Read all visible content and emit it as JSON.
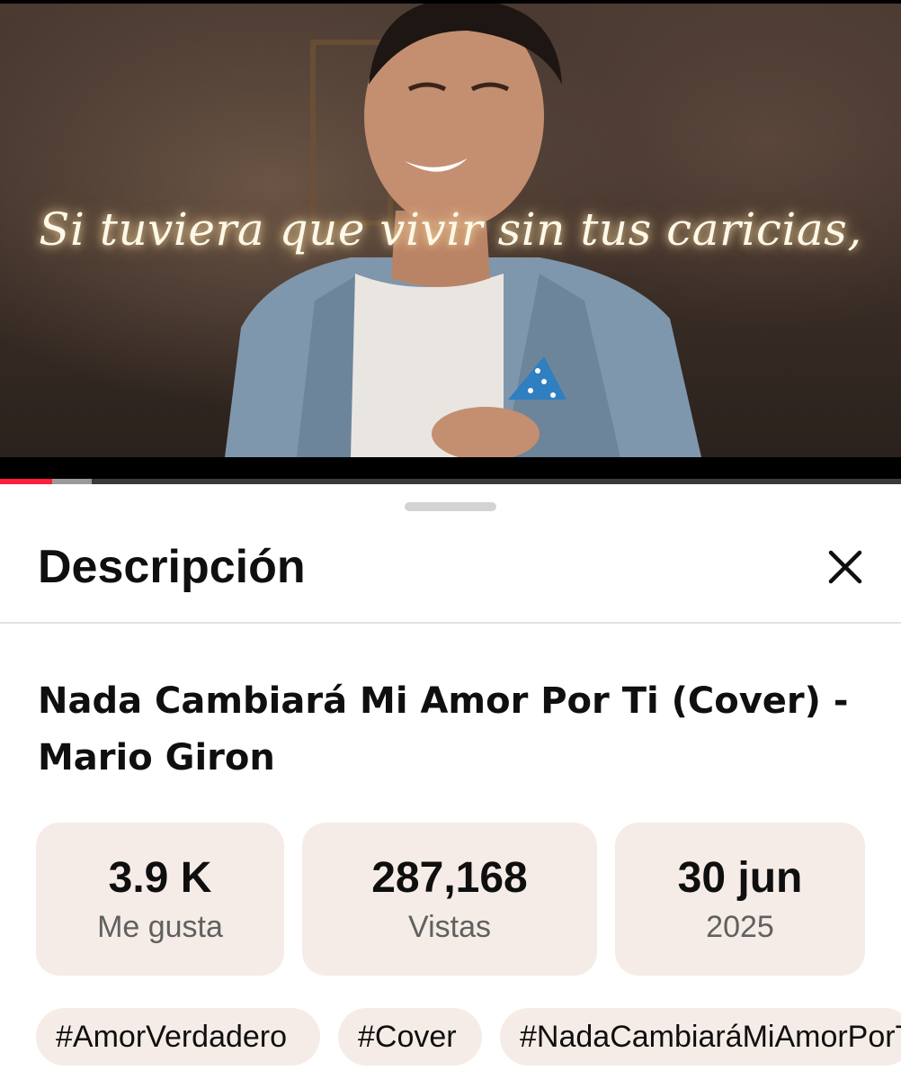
{
  "video": {
    "caption": "Si tuviera que vivir sin tus caricias,",
    "progress": {
      "played_fraction": 0.058,
      "buffered_fraction": 0.102
    },
    "colors": {
      "progress_played": "#ff1f3a"
    }
  },
  "sheet": {
    "title": "Descripción",
    "close_icon": "close-icon"
  },
  "video_info": {
    "title": "Nada Cambiará Mi Amor Por Ti (Cover) - Mario Giron"
  },
  "stats": {
    "likes": {
      "value": "3.9 K",
      "label": "Me gusta"
    },
    "views": {
      "value": "287,168",
      "label": "Vistas"
    },
    "date": {
      "value": "30 jun",
      "label": "2025"
    }
  },
  "hashtags": [
    "#AmorVerdadero",
    "#Cover",
    "#NadaCambiaráMiAmorPorTi"
  ],
  "colors": {
    "card_background": "#f6ece7",
    "text_primary": "#0f0f0f",
    "text_secondary": "#606060"
  }
}
